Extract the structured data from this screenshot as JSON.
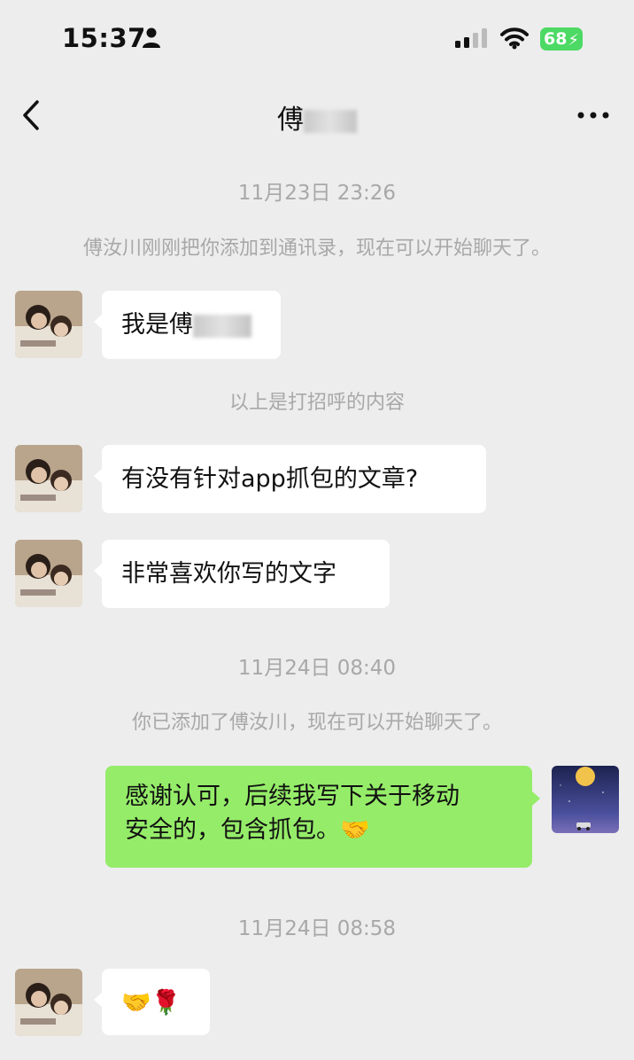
{
  "status": {
    "time": "15:37",
    "battery": "68"
  },
  "chat": {
    "title_visible": "傅",
    "more": "•••"
  },
  "messages": {
    "ts1": "11月23日 23:26",
    "sys1": "傅汝川刚刚把你添加到通讯录，现在可以开始聊天了。",
    "m1": "我是傅",
    "sys2": "以上是打招呼的内容",
    "m2": "有没有针对app抓包的文章?",
    "m3": "非常喜欢你写的文字",
    "ts2": "11月24日 08:40",
    "sys3": "你已添加了傅汝川，现在可以开始聊天了。",
    "m4_line1": "感谢认可，后续我写下关于移动",
    "m4_line2": "安全的，包含抓包。🤝",
    "ts3": "11月24日 08:58",
    "m5": "🤝🌹"
  },
  "colors": {
    "background": "#ededed",
    "sent_bubble": "#95ec69",
    "received_bubble": "#ffffff",
    "battery": "#4cd964"
  }
}
